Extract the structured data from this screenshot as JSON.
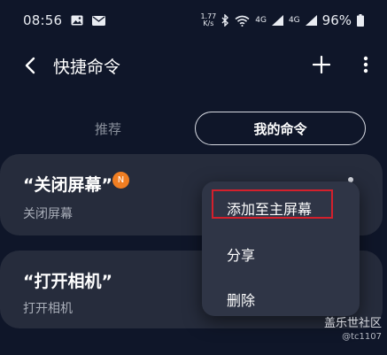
{
  "status_bar": {
    "time": "08:56",
    "net_speed_top": "1.77",
    "net_speed_bottom": "K/s",
    "signal_1": "4G",
    "signal_2": "4G",
    "battery_pct": "96%",
    "icons": [
      "image-icon",
      "mail-icon",
      "bluetooth-icon",
      "wifi-icon",
      "signal-icon",
      "battery-icon"
    ]
  },
  "app_bar": {
    "title": "快捷命令"
  },
  "tabs": [
    {
      "label": "推荐",
      "selected": false
    },
    {
      "label": "我的命令",
      "selected": true
    }
  ],
  "commands": [
    {
      "title": "“关闭屏幕”",
      "subtitle": "关闭屏幕",
      "badge": "N"
    },
    {
      "title": "“打开相机”",
      "subtitle": "打开相机"
    }
  ],
  "popup_menu": {
    "items": [
      {
        "label": "添加至主屏幕",
        "highlighted": true
      },
      {
        "label": "分享"
      },
      {
        "label": "删除"
      }
    ]
  },
  "watermark": {
    "brand": "盖乐世社区",
    "user": "@tc1107"
  },
  "colors": {
    "background": "#0f1629",
    "card": "#262c3c",
    "popup": "#2f3546",
    "badge": "#f07e22",
    "highlight": "#d4202c"
  }
}
